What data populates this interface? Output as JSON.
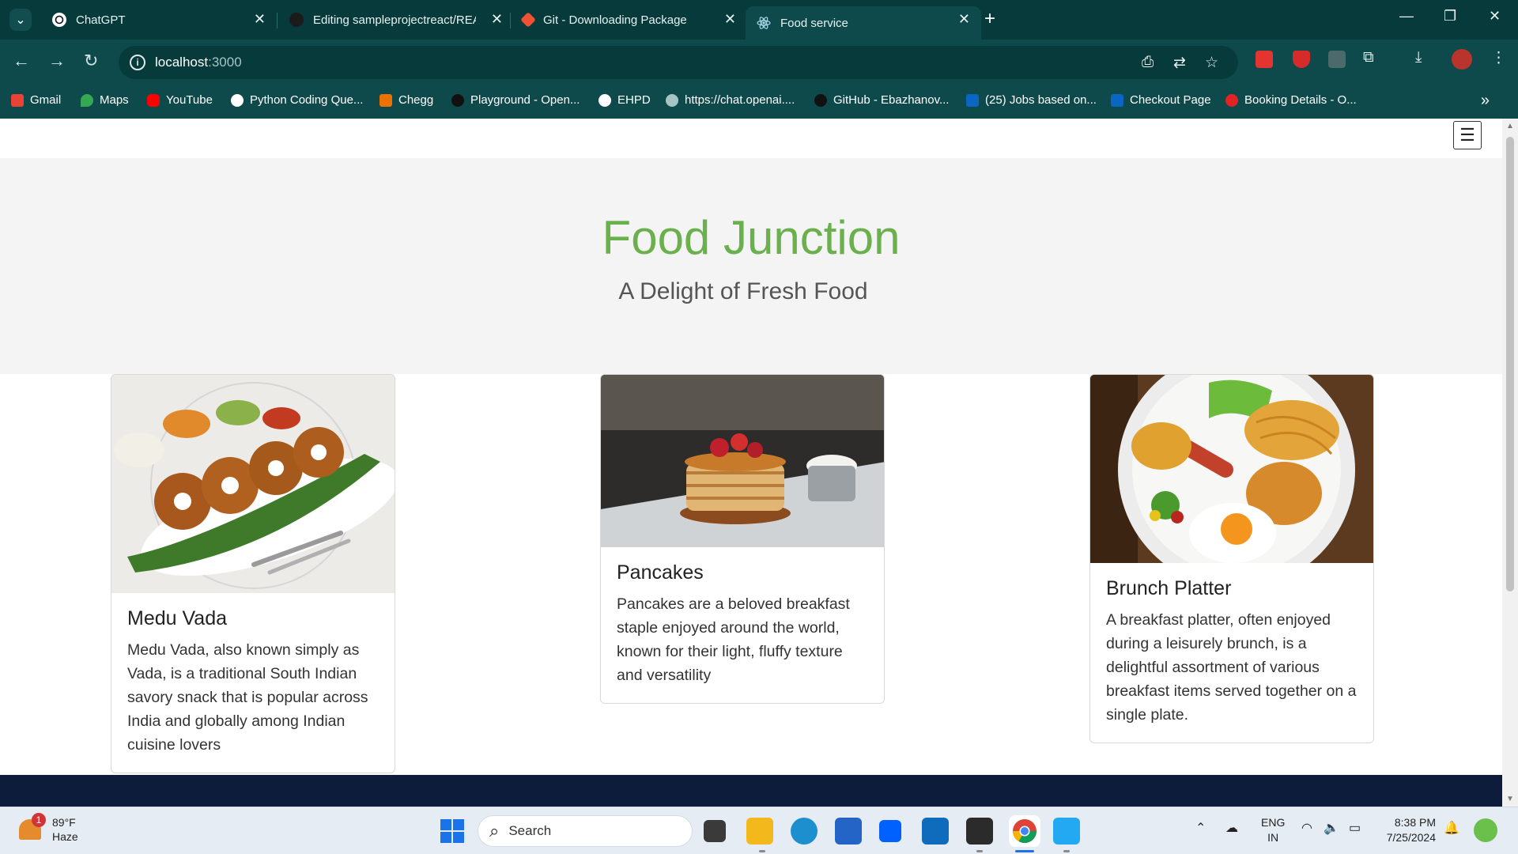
{
  "browser": {
    "tabs": [
      {
        "title": "ChatGPT",
        "icon": "chatgpt-icon"
      },
      {
        "title": "Editing sampleprojectreact/README",
        "icon": "github-icon"
      },
      {
        "title": "Git - Downloading Package",
        "icon": "git-icon"
      },
      {
        "title": "Food service",
        "icon": "react-icon"
      }
    ],
    "new_tab_label": "+",
    "address": {
      "host": "localhost",
      "port": ":3000"
    },
    "bookmarks": [
      {
        "label": "Gmail",
        "color": "#ea4335"
      },
      {
        "label": "Maps",
        "color": "#34a853"
      },
      {
        "label": "YouTube",
        "color": "#ff0000"
      },
      {
        "label": "Python Coding Que...",
        "color": "#ffffff"
      },
      {
        "label": "Chegg",
        "color": "#eb7100"
      },
      {
        "label": "Playground - Open...",
        "color": "#111111"
      },
      {
        "label": "EHPD",
        "color": "#ffffff"
      },
      {
        "label": "https://chat.openai....",
        "color": "#a6c4c4"
      },
      {
        "label": "GitHub - Ebazhanov...",
        "color": "#111111"
      },
      {
        "label": "(25) Jobs based on...",
        "color": "#0a66c2"
      },
      {
        "label": "Checkout Page",
        "color": "#0a66c2"
      },
      {
        "label": "Booking Details - O...",
        "color": "#e02424"
      }
    ]
  },
  "page": {
    "hero": {
      "title": "Food Junction",
      "subtitle": "A Delight of Fresh Food"
    },
    "cards": [
      {
        "title": "Medu Vada",
        "text": "Medu Vada, also known simply as Vada, is a traditional South Indian savory snack that is popular across India and globally among Indian cuisine lovers"
      },
      {
        "title": "Pancakes",
        "text": "Pancakes are a beloved breakfast staple enjoyed around the world, known for their light, fluffy texture and versatility"
      },
      {
        "title": "Brunch Platter",
        "text": "A breakfast platter, often enjoyed during a leisurely brunch, is a delightful assortment of various breakfast items served together on a single plate."
      }
    ],
    "colors": {
      "title": "#6ab04c",
      "hero_bg": "#f4f4f4",
      "footer": "#0c1c3a"
    }
  },
  "taskbar": {
    "weather": {
      "temp": "89°F",
      "condition": "Haze",
      "badge": "1"
    },
    "search_label": "Search",
    "tray": {
      "lang": "ENG",
      "region": "IN"
    },
    "clock": {
      "time": "8:38 PM",
      "date": "7/25/2024"
    }
  }
}
